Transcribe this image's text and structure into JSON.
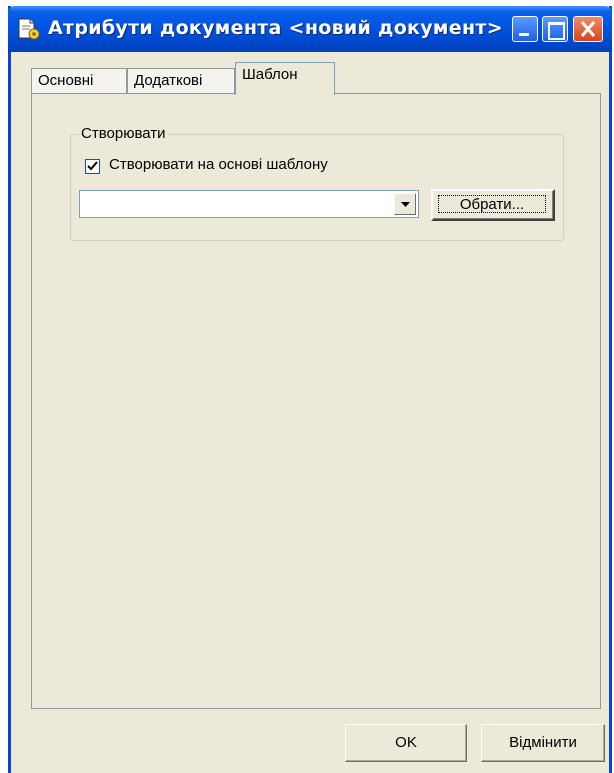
{
  "window": {
    "title": "Атрибути документа <новий документ>"
  },
  "tabs": [
    {
      "label": "Основні"
    },
    {
      "label": "Додаткові"
    },
    {
      "label": "Шаблон",
      "active": true
    }
  ],
  "group": {
    "label": "Створювати",
    "checkbox_label": "Створювати на основі шаблону",
    "checkbox_checked": true,
    "template_value": "",
    "pick_button_label": "Обрати..."
  },
  "buttons": {
    "ok_label": "OK",
    "cancel_label": "Відмінити"
  },
  "colors": {
    "titlebar": "#0054E3",
    "dialog_bg": "#ECE9D8",
    "close_button": "#D6461E"
  },
  "icons": {
    "window": "document-properties-icon",
    "checkbox": "checkmark-icon",
    "combo": "dropdown-arrow-icon"
  }
}
